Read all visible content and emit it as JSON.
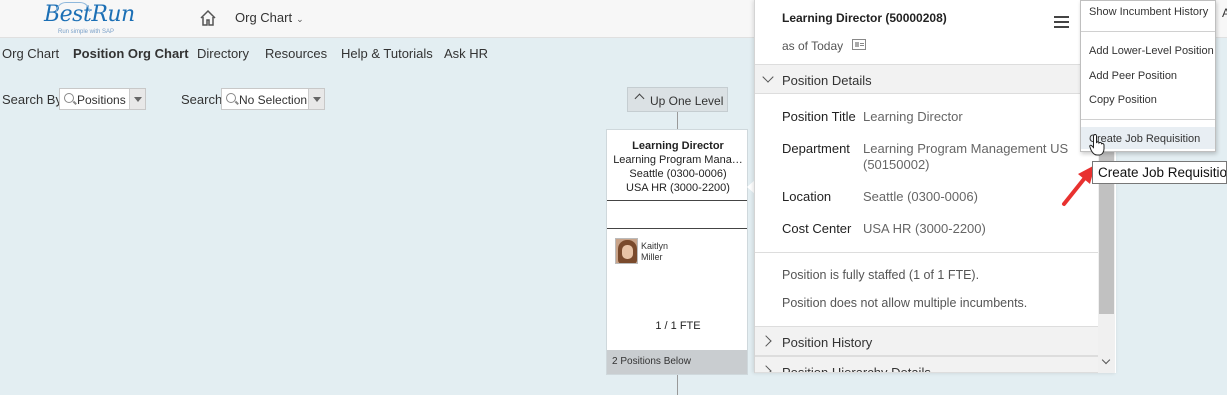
{
  "header": {
    "logo_text": "BestRun",
    "logo_tagline": "Run simple with SAP",
    "module_label": "Org Chart",
    "far_right_text": "A"
  },
  "nav": {
    "items": [
      {
        "label": "Org Chart",
        "active": false
      },
      {
        "label": "Position Org Chart",
        "active": true
      },
      {
        "label": "Directory",
        "active": false
      },
      {
        "label": "Resources",
        "active": false
      },
      {
        "label": "Help & Tutorials",
        "active": false
      },
      {
        "label": "Ask HR",
        "active": false
      }
    ]
  },
  "search": {
    "search_by_label": "Search By",
    "search_by_value": "Positions",
    "search_label": "Search",
    "search_value": "No Selection"
  },
  "chart": {
    "up_one_level_label": "Up One Level",
    "card": {
      "title": "Learning Director",
      "department": "Learning Program Mana…",
      "location": "Seattle (0300-0006)",
      "cost_center": "USA HR (3000-2200)",
      "incumbent_first": "Kaitlyn",
      "incumbent_last": "Miller",
      "fte": "1 / 1 FTE",
      "positions_below": "2 Positions Below"
    }
  },
  "panel": {
    "title": "Learning Director (50000208)",
    "as_of": "as of Today",
    "position_details_header": "Position Details",
    "fields": [
      {
        "label": "Position Title",
        "value": "Learning Director"
      },
      {
        "label": "Department",
        "value": "Learning Program Management US (50150002)"
      },
      {
        "label": "Location",
        "value": "Seattle (0300-0006)"
      },
      {
        "label": "Cost Center",
        "value": "USA HR (3000-2200)"
      }
    ],
    "staffing_note": "Position is fully staffed (1 of 1 FTE).",
    "incumbents_note": "Position does not allow multiple incumbents.",
    "position_history_header": "Position History",
    "position_hierarchy_header": "Position Hierarchy Details"
  },
  "menu": {
    "items": [
      "Show Incumbent History",
      "Add Lower-Level Position",
      "Add Peer Position",
      "Copy Position",
      "Create Job Requisition"
    ]
  },
  "tooltip": {
    "text": "Create Job Requisition"
  },
  "colors": {
    "background": "#e3eef2",
    "logo_blue": "#1b6fb5",
    "annotation_red": "#e8312f"
  }
}
